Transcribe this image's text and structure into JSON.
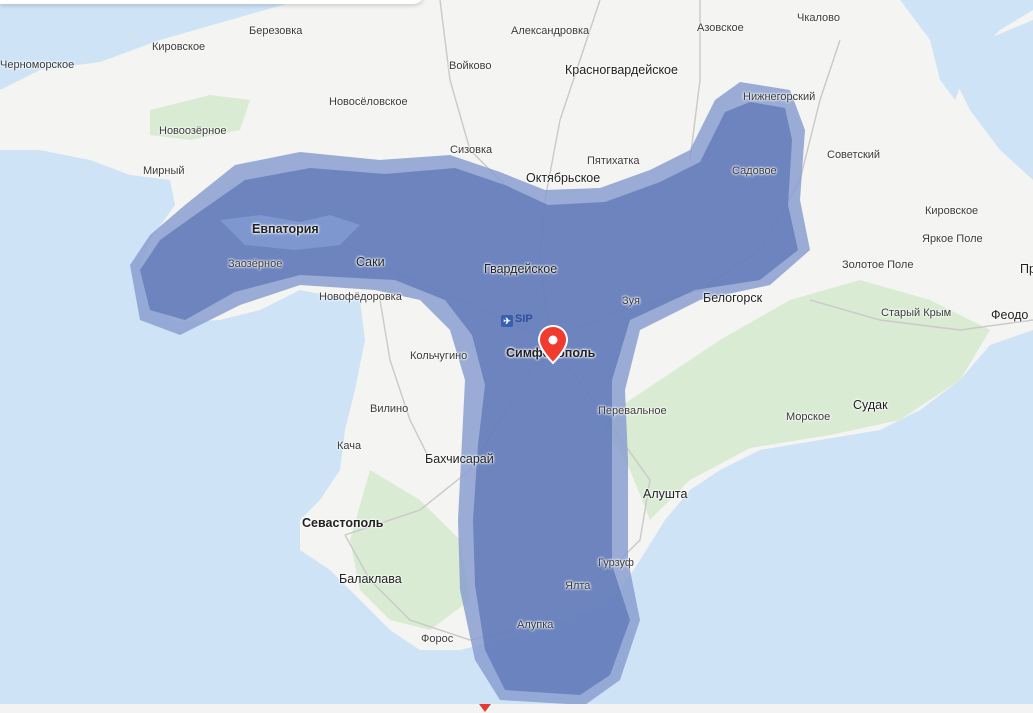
{
  "map": {
    "colors": {
      "sea": "#cfe3f7",
      "land": "#f4f4f2",
      "forest": "#d9ebd3",
      "road": "#c9c9c9",
      "zone_outer": "#8a9fd0",
      "zone_inner": "#5d77b5",
      "pin": "#f03b2e"
    },
    "airport": {
      "code": "SIP",
      "icon": "airplane-icon"
    },
    "marker_icon": "location-pin-icon",
    "places": [
      {
        "id": "chernomorskoe",
        "name": "Черноморское"
      },
      {
        "id": "kirovskoe-w",
        "name": "Кировское"
      },
      {
        "id": "berezovka",
        "name": "Березовка"
      },
      {
        "id": "aleksandrovka",
        "name": "Александровка"
      },
      {
        "id": "azovskoe",
        "name": "Азовское"
      },
      {
        "id": "chkalovo",
        "name": "Чкалово"
      },
      {
        "id": "voykovo",
        "name": "Войково"
      },
      {
        "id": "krasnogvardeyskoe",
        "name": "Красногвардейское"
      },
      {
        "id": "nizhnegorskiy",
        "name": "Нижнегорский"
      },
      {
        "id": "novoselovskoe",
        "name": "Новосёловское"
      },
      {
        "id": "novoozernoe",
        "name": "Новоозёрное"
      },
      {
        "id": "sizovka",
        "name": "Сизовка"
      },
      {
        "id": "pyatikhatka",
        "name": "Пятихатка"
      },
      {
        "id": "sovetskiy",
        "name": "Советский"
      },
      {
        "id": "mirnyy",
        "name": "Мирный"
      },
      {
        "id": "oktyabrskoe",
        "name": "Октябрьское"
      },
      {
        "id": "sadovoe",
        "name": "Садовое"
      },
      {
        "id": "kirovskoe-e",
        "name": "Кировское"
      },
      {
        "id": "evpatoriya",
        "name": "Евпатория"
      },
      {
        "id": "yarkoe-pole",
        "name": "Яркое Поле"
      },
      {
        "id": "zaozernoe",
        "name": "Заозёрное"
      },
      {
        "id": "saki",
        "name": "Саки"
      },
      {
        "id": "gvardeyskoe",
        "name": "Гвардейское"
      },
      {
        "id": "zolotoe-pole",
        "name": "Золотое Поле"
      },
      {
        "id": "pr",
        "name": "Пр"
      },
      {
        "id": "novofedorovka",
        "name": "Новофёдоровка"
      },
      {
        "id": "zuya",
        "name": "Зуя"
      },
      {
        "id": "belogorsk",
        "name": "Белогорск"
      },
      {
        "id": "staryy-krym",
        "name": "Старый Крым"
      },
      {
        "id": "feodosiya",
        "name": "Феодо"
      },
      {
        "id": "kolchugino",
        "name": "Кольчугино"
      },
      {
        "id": "simferopol",
        "name": "Симферополь"
      },
      {
        "id": "vilino",
        "name": "Вилино"
      },
      {
        "id": "perevalnoe",
        "name": "Перевальное"
      },
      {
        "id": "morskoe",
        "name": "Морское"
      },
      {
        "id": "sudak",
        "name": "Судак"
      },
      {
        "id": "kacha",
        "name": "Кача"
      },
      {
        "id": "bakhchisaray",
        "name": "Бахчисарай"
      },
      {
        "id": "alushta",
        "name": "Алушта"
      },
      {
        "id": "sevastopol",
        "name": "Севастополь"
      },
      {
        "id": "gurzuf",
        "name": "Гурзуф"
      },
      {
        "id": "balaklava",
        "name": "Балаклава"
      },
      {
        "id": "yalta",
        "name": "Ялта"
      },
      {
        "id": "alupka",
        "name": "Алупка"
      },
      {
        "id": "foros",
        "name": "Форос"
      }
    ]
  }
}
